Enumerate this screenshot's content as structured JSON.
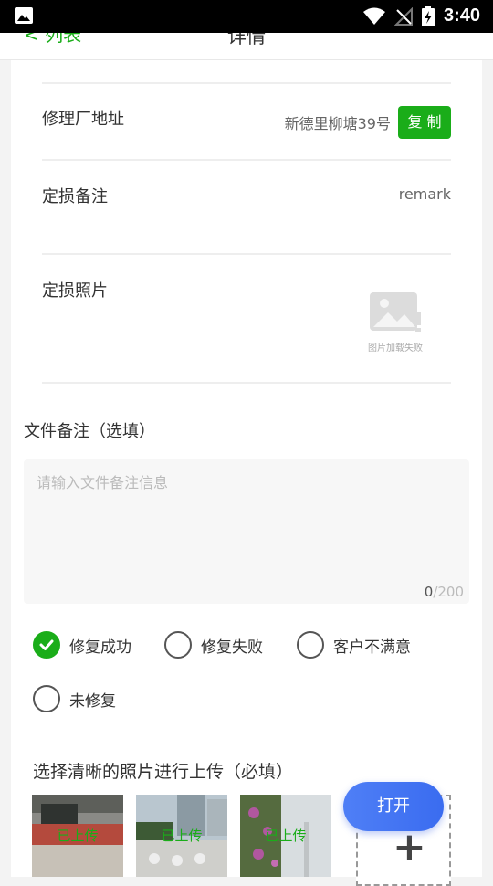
{
  "status_bar": {
    "time": "3:40"
  },
  "nav": {
    "back_label": "< 列表",
    "title": "详情"
  },
  "detail": {
    "repair_shop_address_label": "修理厂地址",
    "repair_shop_address_value": "新德里柳塘39号",
    "copy_label": "复 制",
    "loss_remark_label": "定损备注",
    "loss_remark_value": "remark",
    "loss_photo_label": "定损照片",
    "image_failed_caption": "图片加载失败"
  },
  "file_remark": {
    "label": "文件备注（选填）",
    "placeholder": "请输入文件备注信息",
    "count": "0",
    "max": "/200"
  },
  "repair_status": {
    "options": [
      {
        "label": "修复成功",
        "checked": true
      },
      {
        "label": "修复失败",
        "checked": false
      },
      {
        "label": "客户不满意",
        "checked": false
      },
      {
        "label": "未修复",
        "checked": false
      }
    ]
  },
  "upload": {
    "label": "选择清晰的照片进行上传（必填）",
    "uploaded_tag": "已上传",
    "add_symbol": "+"
  },
  "open_button_label": "打开",
  "colors": {
    "accent_green": "#1aad19",
    "open_button_blue": "#4f7ff6"
  }
}
